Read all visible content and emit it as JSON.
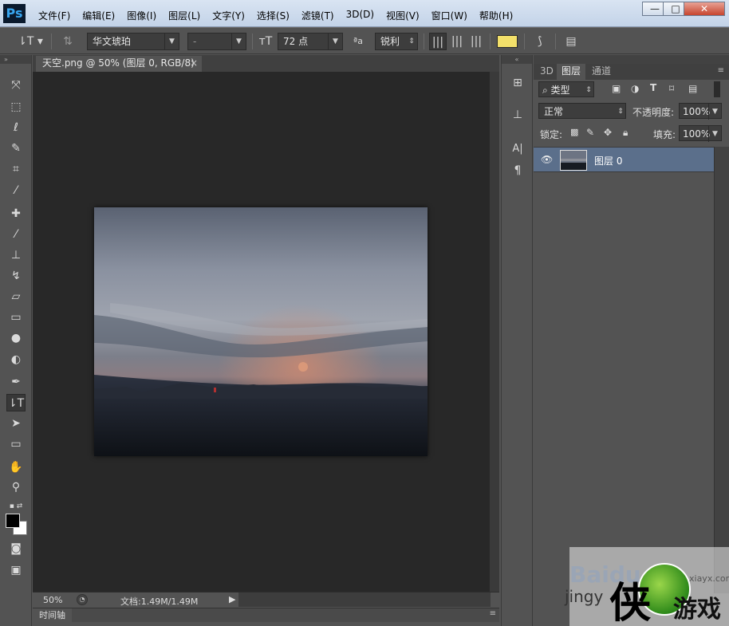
{
  "app": {
    "logo": "Ps"
  },
  "menu": [
    "文件(F)",
    "编辑(E)",
    "图像(I)",
    "图层(L)",
    "文字(Y)",
    "选择(S)",
    "滤镜(T)",
    "3D(D)",
    "视图(V)",
    "窗口(W)",
    "帮助(H)"
  ],
  "window_controls": {
    "minimize": "—",
    "maximize": "□",
    "close": "✕"
  },
  "options": {
    "font_family": "华文琥珀",
    "font_style": "-",
    "font_size": "72 点",
    "antialias": "锐利",
    "text_color": "#f3e06a"
  },
  "document": {
    "tab_title": "天空.png @ 50% (图层 0, RGB/8)",
    "tab_close": "×",
    "zoom": "50%",
    "doc_info": "文档:1.49M/1.49M",
    "timeline": "时间轴"
  },
  "layers_panel": {
    "tabs": [
      "3D",
      "图层",
      "通道"
    ],
    "active_tab": "图层",
    "filter_kind": "类型",
    "blend_mode": "正常",
    "opacity_label": "不透明度:",
    "opacity_value": "100%",
    "lock_label": "锁定:",
    "fill_label": "填充:",
    "fill_value": "100%",
    "layers": [
      {
        "name": "图层 0",
        "visible": true,
        "selected": true
      }
    ]
  },
  "watermark": {
    "baidu": "Baidu",
    "jingyan": "jingy",
    "site": "xiayx.com",
    "char": "侠",
    "game": "游戏"
  }
}
